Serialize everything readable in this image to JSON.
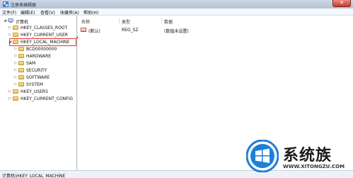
{
  "window": {
    "title": "注册表编辑器",
    "close_label": "✕"
  },
  "menubar": {
    "items": [
      {
        "label": "文件(F)"
      },
      {
        "label": "编辑(E)"
      },
      {
        "label": "查看(V)"
      },
      {
        "label": "收藏夹(A)"
      },
      {
        "label": "帮助(H)"
      }
    ]
  },
  "tree": {
    "root": "计算机",
    "hives": [
      {
        "label": "HKEY_CLASSES_ROOT"
      },
      {
        "label": "HKEY_CURRENT_USER"
      },
      {
        "label": "HKEY_LOCAL_MACHINE"
      },
      {
        "label": "HKEY_USERS"
      },
      {
        "label": "HKEY_CURRENT_CONFIG"
      }
    ],
    "local_machine_children": [
      {
        "label": "BCD00000000"
      },
      {
        "label": "HARDWARE"
      },
      {
        "label": "SAM"
      },
      {
        "label": "SECURITY"
      },
      {
        "label": "SOFTWARE"
      },
      {
        "label": "SYSTEM"
      }
    ]
  },
  "list": {
    "headers": {
      "name": "名称",
      "type": "类型",
      "data": "数据"
    },
    "rows": [
      {
        "name": "(默认)",
        "type": "REG_SZ",
        "data": "(数值未设置)",
        "icon": "ab"
      }
    ]
  },
  "statusbar": {
    "path": "计算机\\HKEY_LOCAL_MACHINE"
  },
  "watermark": {
    "name": "系统族",
    "url": "WWW.XITONGZU.COM"
  },
  "colors": {
    "highlight": "#e0322b",
    "titlebar": "#b6c3d6",
    "logo_blue": "#1e7fd6"
  }
}
